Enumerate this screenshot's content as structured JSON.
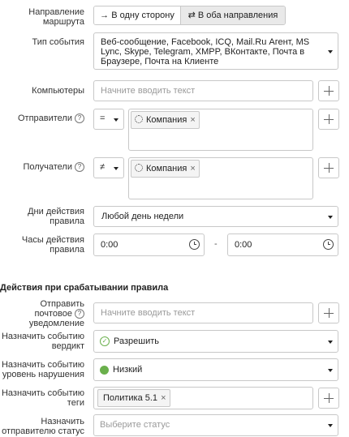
{
  "route": {
    "label_line1": "Направление",
    "label_line2": "маршрута",
    "option_one_way": "→ В одну сторону",
    "option_both": "⇄ В оба направления"
  },
  "event_type": {
    "label": "Тип события",
    "value_line1": "Веб-сообщение, Facebook, ICQ, Mail.Ru Агент, MS",
    "value_line2": "Lync, Skype, Telegram, XMPP, ВКонтакте, Почта в",
    "value_line3": "Браузере, Почта на Клиенте"
  },
  "computers": {
    "label": "Компьютеры",
    "placeholder": "Начните вводить текст"
  },
  "senders": {
    "label": "Отправители",
    "operator": "=",
    "tag": "Компания"
  },
  "recipients": {
    "label": "Получатели",
    "operator": "≠",
    "tag": "Компания"
  },
  "days": {
    "label_line1": "Дни действия",
    "label_line2": "правила",
    "value": "Любой день недели"
  },
  "hours": {
    "label_line1": "Часы действия",
    "label_line2": "правила",
    "from": "0:00",
    "separator": "-",
    "to": "0:00"
  },
  "actions": {
    "heading": "Действия при срабатывании правила",
    "notify": {
      "label_line1": "Отправить",
      "label_line2": "почтовое",
      "label_line3": "уведомление",
      "placeholder": "Начните вводить текст"
    },
    "verdict": {
      "label_line1": "Назначить событию",
      "label_line2": "вердикт",
      "value": "Разрешить"
    },
    "severity": {
      "label_line1": "Назначить событию",
      "label_line2": "уровень нарушения",
      "value": "Низкий",
      "color": "#6ab04c"
    },
    "tags": {
      "label_line1": "Назначить событию",
      "label_line2": "теги",
      "tag": "Политика 5.1"
    },
    "status": {
      "label_line1": "Назначить",
      "label_line2": "отправителю статус",
      "placeholder": "Выберите статус"
    }
  },
  "help_glyph": "?",
  "remove_glyph": "×"
}
